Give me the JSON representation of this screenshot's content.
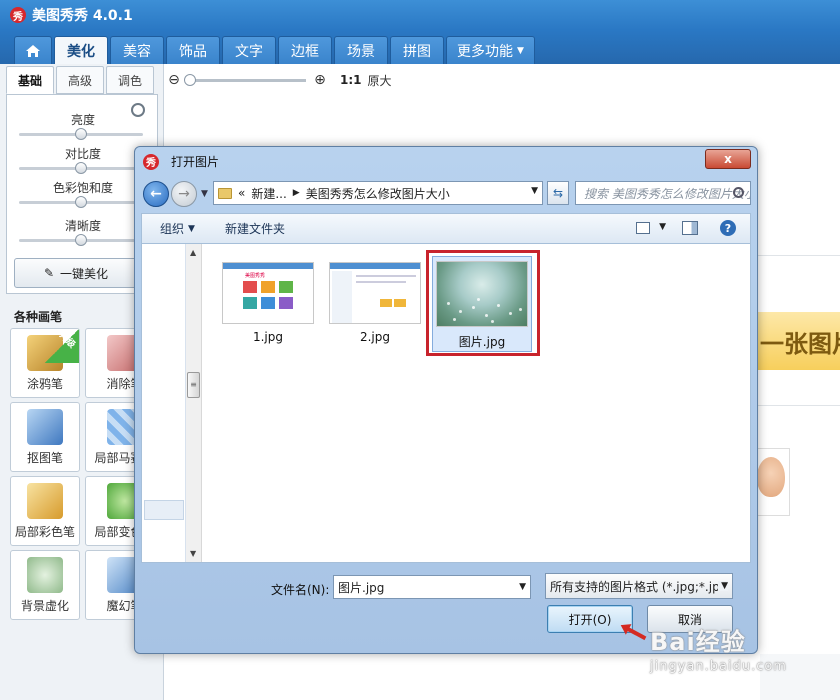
{
  "app": {
    "title": "美图秀秀 4.0.1",
    "logo_char": "秀"
  },
  "nav": {
    "tabs": [
      {
        "label": "美化",
        "active": true
      },
      {
        "label": "美容"
      },
      {
        "label": "饰品"
      },
      {
        "label": "文字"
      },
      {
        "label": "边框"
      },
      {
        "label": "场景"
      },
      {
        "label": "拼图"
      },
      {
        "label": "更多功能"
      }
    ]
  },
  "left": {
    "sub_tabs": [
      "基础",
      "高级",
      "调色"
    ],
    "sliders": [
      {
        "label": "亮度",
        "value": 0.5
      },
      {
        "label": "对比度",
        "value": 0.5
      },
      {
        "label": "色彩饱和度",
        "value": 0.5
      },
      {
        "label": "清晰度",
        "value": 0.5
      }
    ],
    "one_key_label": "一键美化",
    "brush_title": "各种画笔",
    "tools": [
      {
        "label": "涂鸦笔",
        "badge": "升级"
      },
      {
        "label": "消除笔"
      },
      {
        "label": "抠图笔"
      },
      {
        "label": "局部马赛克"
      },
      {
        "label": "局部彩色笔"
      },
      {
        "label": "局部变色笔"
      },
      {
        "label": "背景虚化"
      },
      {
        "label": "魔幻笔"
      }
    ]
  },
  "canvas": {
    "zoom_ratio": "1:1",
    "zoom_orig": "原大",
    "zoom_level": 0.0,
    "banner_text": "一张图片"
  },
  "dialog": {
    "title": "打开图片",
    "close": "x",
    "path_prefix": "«",
    "path_parts": [
      "新建...",
      "美图秀秀怎么修改图片大小"
    ],
    "search_placeholder": "搜索 美图秀秀怎么修改图片大小",
    "cmd": {
      "organize": "组织",
      "new_folder": "新建文件夹"
    },
    "files": [
      {
        "name": "1.jpg"
      },
      {
        "name": "2.jpg"
      },
      {
        "name": "图片.jpg",
        "selected": true
      }
    ],
    "filename_label": "文件名(N):",
    "filename_value": "图片.jpg",
    "filetype_value": "所有支持的图片格式 (*.jpg;*.jp",
    "open_button": "打开(O)",
    "cancel_button": "取消"
  },
  "thumb1": {
    "title": "美图秀秀"
  },
  "watermark": {
    "main": "Bai经验",
    "sub": "jingyan.baidu.com"
  },
  "colors": {
    "accent": "#2a78c4",
    "highlight": "#c8232c"
  }
}
